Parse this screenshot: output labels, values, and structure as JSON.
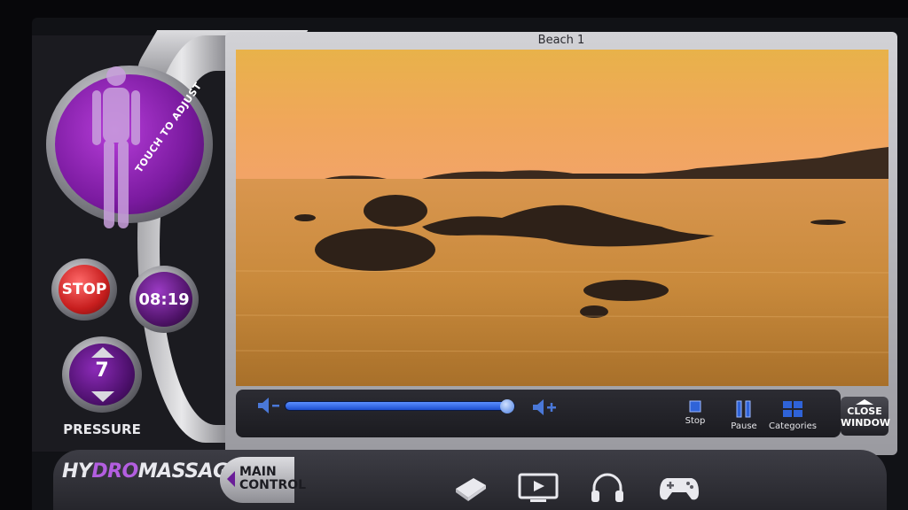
{
  "window": {
    "title": "Beach 1"
  },
  "left_panel": {
    "body_button_label": "TOUCH TO ADJUST",
    "stop_label": "STOP",
    "timer": "08:19",
    "pressure_value": "7",
    "pressure_label": "PRESSURE"
  },
  "player": {
    "volume_level": 0.97,
    "controls": [
      {
        "label": "Stop",
        "icon": "stop-icon"
      },
      {
        "label": "Pause",
        "icon": "pause-icon"
      },
      {
        "label": "Categories",
        "icon": "categories-icon"
      }
    ],
    "close_label_1": "CLOSE",
    "close_label_2": "WINDOW"
  },
  "bottom_bar": {
    "logo_a": "HY",
    "logo_b": "DRO",
    "logo_c": "MASSAGE",
    "main_control_1": "MAIN",
    "main_control_2": "CONTROL",
    "nav_icons": [
      "book-icon",
      "video-icon",
      "headphones-icon",
      "gamepad-icon"
    ]
  },
  "colors": {
    "accent_purple": "#7a1a9f",
    "stop_red": "#c71e1e",
    "slider_blue": "#1d4fd1"
  }
}
